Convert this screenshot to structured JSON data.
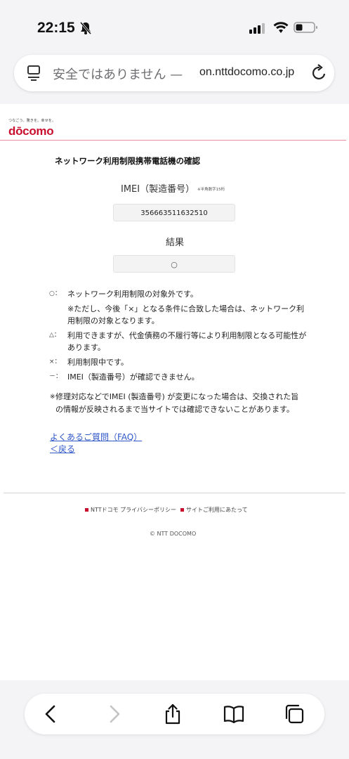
{
  "status_bar": {
    "time": "22:15"
  },
  "browser": {
    "insecure_label": "安全ではありません —",
    "domain": "on.nttdocomo.co.jp"
  },
  "brand": {
    "tagline": "つなごう。驚きを。幸せを。",
    "logo_text": "dōcomo"
  },
  "page": {
    "title": "ネットワーク利用制限携帯電話機の確認",
    "imei_label": "IMEI（製造番号）",
    "imei_note": "※半角数字15桁",
    "imei_value": "356663511632510",
    "result_label": "結果",
    "result_value": "○",
    "legend": [
      {
        "symbol": "○：",
        "text": "ネットワーク利用制限の対象外です。"
      },
      {
        "symbol": "",
        "text": "※ただし、今後「×」となる条件に合致した場合は、ネットワーク利用制限の対象となります。"
      },
      {
        "symbol": "△：",
        "text": "利用できますが、代金債務の不履行等により利用制限となる可能性があります。"
      },
      {
        "symbol": "×：",
        "text": "利用制限中です。"
      },
      {
        "symbol": "－：",
        "text": "IMEI（製造番号）が確認できません。"
      }
    ],
    "notice_mark": "※",
    "notice": "修理対応などでIMEI (製造番号) が変更になった場合は、交換された旨の情報が反映されるまで当サイトでは確認できないことがあります。",
    "faq_link": "よくあるご質問（FAQ）",
    "back_link": "＜戻る"
  },
  "footer": {
    "privacy_link": "NTTドコモ プライバシーポリシー",
    "terms_link": "サイトご利用にあたって",
    "copyright": "© NTT DOCOMO"
  },
  "toolbar_icons": [
    "back-icon",
    "forward-icon",
    "share-icon",
    "bookmarks-icon",
    "tabs-icon"
  ],
  "colors": {
    "brand_red": "#c8102e",
    "link_blue": "#2f57c8"
  }
}
